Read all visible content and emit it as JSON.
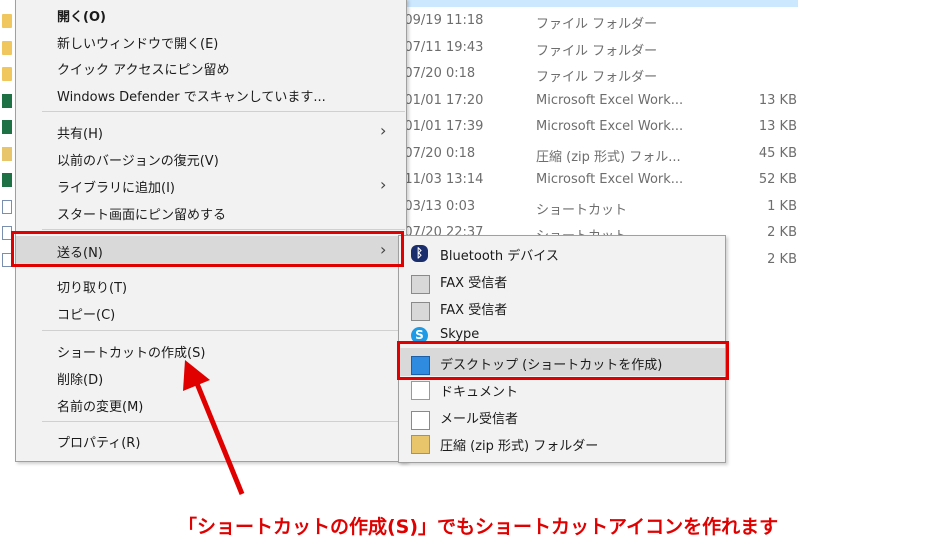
{
  "file_list": {
    "rows": [
      {
        "icon": "folder-icon",
        "date": "/09/19 11:18",
        "type": "ファイル フォルダー",
        "size": ""
      },
      {
        "icon": "folder-icon",
        "date": "/07/11 19:43",
        "type": "ファイル フォルダー",
        "size": ""
      },
      {
        "icon": "folder-icon",
        "date": "/07/20 0:18",
        "type": "ファイル フォルダー",
        "size": ""
      },
      {
        "icon": "excel-file-icon",
        "date": "/01/01 17:20",
        "type": "Microsoft Excel Work...",
        "size": "13 KB"
      },
      {
        "icon": "excel-file-icon",
        "date": "/01/01 17:39",
        "type": "Microsoft Excel Work...",
        "size": "13 KB"
      },
      {
        "icon": "zip-file-icon",
        "date": "/07/20 0:18",
        "type": "圧縮 (zip 形式) フォル...",
        "size": "45 KB"
      },
      {
        "icon": "excel-file-icon",
        "date": "/11/03 13:14",
        "type": "Microsoft Excel Work...",
        "size": "52 KB"
      },
      {
        "icon": "shortcut-file-icon",
        "date": "/03/13 0:03",
        "type": "ショートカット",
        "size": "1 KB"
      },
      {
        "icon": "shortcut-file-icon",
        "date": "/07/20 22:37",
        "type": "ショートカット",
        "size": "2 KB"
      },
      {
        "icon": "shortcut-file-icon",
        "date": "",
        "type": "",
        "size": "2 KB"
      }
    ]
  },
  "context_menu": {
    "open": "開く(O)",
    "open_new_window": "新しいウィンドウで開く(E)",
    "pin_quick_access": "クイック アクセスにピン留め",
    "defender_scan": "Windows Defender でスキャンしています...",
    "share": "共有(H)",
    "restore_previous": "以前のバージョンの復元(V)",
    "add_to_library": "ライブラリに追加(I)",
    "pin_start": "スタート画面にピン留めする",
    "send_to": "送る(N)",
    "cut": "切り取り(T)",
    "copy": "コピー(C)",
    "create_shortcut": "ショートカットの作成(S)",
    "delete": "削除(D)",
    "rename": "名前の変更(M)",
    "properties": "プロパティ(R)"
  },
  "send_to_menu": {
    "bluetooth": "Bluetooth デバイス",
    "fax1": "FAX 受信者",
    "fax2": "FAX 受信者",
    "skype": "Skype",
    "desktop_shortcut": "デスクトップ (ショートカットを作成)",
    "documents": "ドキュメント",
    "mail": "メール受信者",
    "zip_folder": "圧縮 (zip 形式) フォルダー"
  },
  "annotation": {
    "caption": "「ショートカットの作成(S)」でもショートカットアイコンを作れます",
    "color": "#e00000"
  },
  "colors": {
    "menu_bg": "#f2f2f2",
    "highlight": "#d9d9d9",
    "selection": "#cce8ff"
  }
}
